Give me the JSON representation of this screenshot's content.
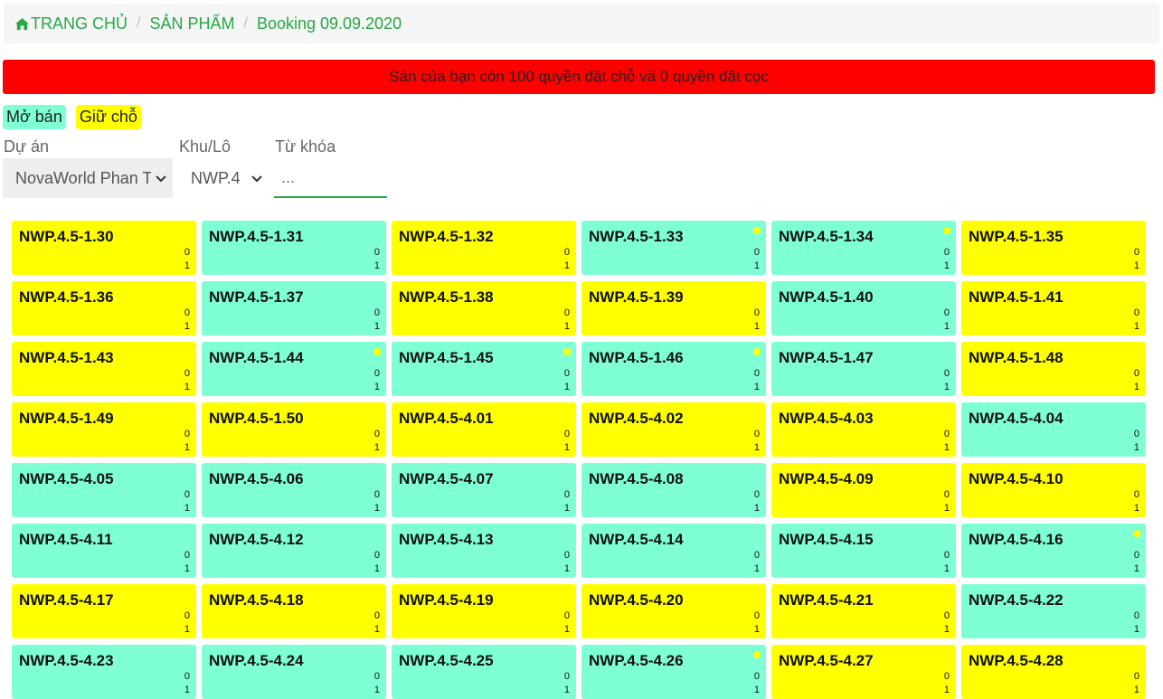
{
  "breadcrumb": {
    "home_label": "TRANG CHỦ",
    "products_label": "SẢN PHẨM",
    "current_label": "Booking 09.09.2020",
    "separator": "/"
  },
  "alert": {
    "message": "Sàn của bạn còn 100 quyền đặt chỗ và 0 quyền đặt cọc"
  },
  "legend": {
    "open_label": "Mở bán",
    "hold_label": "Giữ chỗ"
  },
  "filters": {
    "project_label": "Dự án",
    "project_value": "NovaWorld Phan Thiết",
    "zone_label": "Khu/Lô",
    "zone_value": "NWP.4",
    "keyword_label": "Từ khóa",
    "keyword_placeholder": "..."
  },
  "colors": {
    "open": "#7fffd4",
    "hold": "#ffff00",
    "alert": "#ff0000",
    "link": "#28a745"
  },
  "units": [
    {
      "code": "NWP.4.5-1.30",
      "status": "hold",
      "a": "0",
      "b": "1",
      "dot": false
    },
    {
      "code": "NWP.4.5-1.31",
      "status": "open",
      "a": "0",
      "b": "1",
      "dot": false
    },
    {
      "code": "NWP.4.5-1.32",
      "status": "hold",
      "a": "0",
      "b": "1",
      "dot": false
    },
    {
      "code": "NWP.4.5-1.33",
      "status": "open",
      "a": "0",
      "b": "1",
      "dot": true
    },
    {
      "code": "NWP.4.5-1.34",
      "status": "open",
      "a": "0",
      "b": "1",
      "dot": true
    },
    {
      "code": "NWP.4.5-1.35",
      "status": "hold",
      "a": "0",
      "b": "1",
      "dot": false
    },
    {
      "code": "NWP.4.5-1.36",
      "status": "hold",
      "a": "0",
      "b": "1",
      "dot": false
    },
    {
      "code": "NWP.4.5-1.37",
      "status": "open",
      "a": "0",
      "b": "1",
      "dot": false
    },
    {
      "code": "NWP.4.5-1.38",
      "status": "hold",
      "a": "0",
      "b": "1",
      "dot": false
    },
    {
      "code": "NWP.4.5-1.39",
      "status": "hold",
      "a": "0",
      "b": "1",
      "dot": false
    },
    {
      "code": "NWP.4.5-1.40",
      "status": "open",
      "a": "0",
      "b": "1",
      "dot": false
    },
    {
      "code": "NWP.4.5-1.41",
      "status": "hold",
      "a": "0",
      "b": "1",
      "dot": false
    },
    {
      "code": "NWP.4.5-1.43",
      "status": "hold",
      "a": "0",
      "b": "1",
      "dot": false
    },
    {
      "code": "NWP.4.5-1.44",
      "status": "open",
      "a": "0",
      "b": "1",
      "dot": true
    },
    {
      "code": "NWP.4.5-1.45",
      "status": "open",
      "a": "0",
      "b": "1",
      "dot": true
    },
    {
      "code": "NWP.4.5-1.46",
      "status": "open",
      "a": "0",
      "b": "1",
      "dot": true
    },
    {
      "code": "NWP.4.5-1.47",
      "status": "open",
      "a": "0",
      "b": "1",
      "dot": false
    },
    {
      "code": "NWP.4.5-1.48",
      "status": "hold",
      "a": "0",
      "b": "1",
      "dot": false
    },
    {
      "code": "NWP.4.5-1.49",
      "status": "hold",
      "a": "0",
      "b": "1",
      "dot": false
    },
    {
      "code": "NWP.4.5-1.50",
      "status": "hold",
      "a": "0",
      "b": "1",
      "dot": false
    },
    {
      "code": "NWP.4.5-4.01",
      "status": "hold",
      "a": "0",
      "b": "1",
      "dot": false
    },
    {
      "code": "NWP.4.5-4.02",
      "status": "hold",
      "a": "0",
      "b": "1",
      "dot": false
    },
    {
      "code": "NWP.4.5-4.03",
      "status": "hold",
      "a": "0",
      "b": "1",
      "dot": false
    },
    {
      "code": "NWP.4.5-4.04",
      "status": "open",
      "a": "0",
      "b": "1",
      "dot": false
    },
    {
      "code": "NWP.4.5-4.05",
      "status": "open",
      "a": "0",
      "b": "1",
      "dot": false
    },
    {
      "code": "NWP.4.5-4.06",
      "status": "open",
      "a": "0",
      "b": "1",
      "dot": false
    },
    {
      "code": "NWP.4.5-4.07",
      "status": "open",
      "a": "0",
      "b": "1",
      "dot": false
    },
    {
      "code": "NWP.4.5-4.08",
      "status": "open",
      "a": "0",
      "b": "1",
      "dot": false
    },
    {
      "code": "NWP.4.5-4.09",
      "status": "hold",
      "a": "0",
      "b": "1",
      "dot": false
    },
    {
      "code": "NWP.4.5-4.10",
      "status": "hold",
      "a": "0",
      "b": "1",
      "dot": false
    },
    {
      "code": "NWP.4.5-4.11",
      "status": "open",
      "a": "0",
      "b": "1",
      "dot": false
    },
    {
      "code": "NWP.4.5-4.12",
      "status": "open",
      "a": "0",
      "b": "1",
      "dot": false
    },
    {
      "code": "NWP.4.5-4.13",
      "status": "open",
      "a": "0",
      "b": "1",
      "dot": false
    },
    {
      "code": "NWP.4.5-4.14",
      "status": "open",
      "a": "0",
      "b": "1",
      "dot": false
    },
    {
      "code": "NWP.4.5-4.15",
      "status": "open",
      "a": "0",
      "b": "1",
      "dot": false
    },
    {
      "code": "NWP.4.5-4.16",
      "status": "open",
      "a": "0",
      "b": "1",
      "dot": true
    },
    {
      "code": "NWP.4.5-4.17",
      "status": "hold",
      "a": "0",
      "b": "1",
      "dot": false
    },
    {
      "code": "NWP.4.5-4.18",
      "status": "hold",
      "a": "0",
      "b": "1",
      "dot": false
    },
    {
      "code": "NWP.4.5-4.19",
      "status": "hold",
      "a": "0",
      "b": "1",
      "dot": false
    },
    {
      "code": "NWP.4.5-4.20",
      "status": "hold",
      "a": "0",
      "b": "1",
      "dot": false
    },
    {
      "code": "NWP.4.5-4.21",
      "status": "hold",
      "a": "0",
      "b": "1",
      "dot": false
    },
    {
      "code": "NWP.4.5-4.22",
      "status": "open",
      "a": "0",
      "b": "1",
      "dot": false
    },
    {
      "code": "NWP.4.5-4.23",
      "status": "open",
      "a": "0",
      "b": "1",
      "dot": false
    },
    {
      "code": "NWP.4.5-4.24",
      "status": "open",
      "a": "0",
      "b": "1",
      "dot": false
    },
    {
      "code": "NWP.4.5-4.25",
      "status": "open",
      "a": "0",
      "b": "1",
      "dot": false
    },
    {
      "code": "NWP.4.5-4.26",
      "status": "open",
      "a": "0",
      "b": "1",
      "dot": true
    },
    {
      "code": "NWP.4.5-4.27",
      "status": "hold",
      "a": "0",
      "b": "1",
      "dot": false
    },
    {
      "code": "NWP.4.5-4.28",
      "status": "hold",
      "a": "0",
      "b": "1",
      "dot": false
    }
  ]
}
